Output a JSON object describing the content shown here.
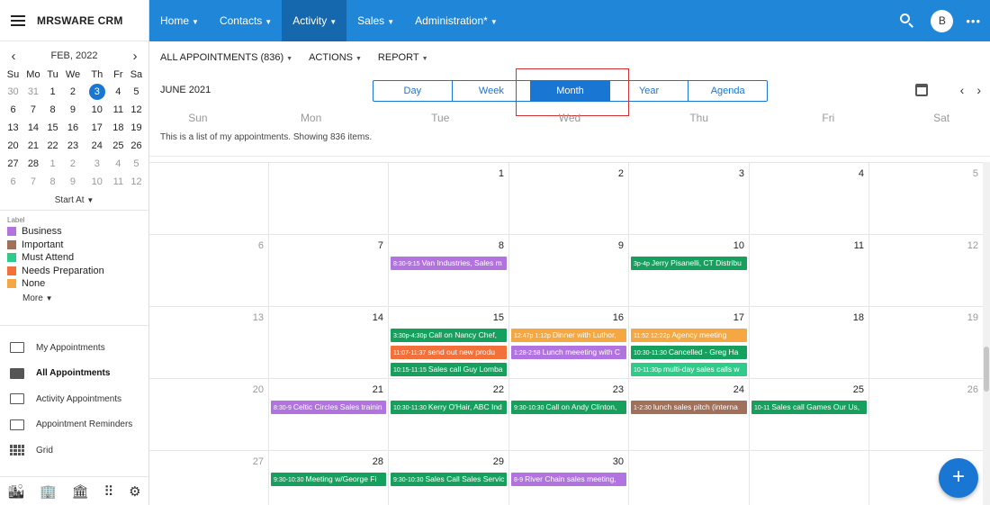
{
  "app": {
    "title": "MRSWARE CRM"
  },
  "colors": {
    "topbar": "#1f86d8",
    "accent": "#1976d2",
    "business": "#b173e0",
    "important": "#a0705a",
    "must_attend": "#2ecc8a",
    "needs_preparation": "#f2703a",
    "none": "#f5a742",
    "event_green": "#16a05e"
  },
  "nav": {
    "items": [
      {
        "label": "Home"
      },
      {
        "label": "Contacts"
      },
      {
        "label": "Activity"
      },
      {
        "label": "Sales"
      },
      {
        "label": "Administration*"
      }
    ],
    "avatar_letter": "B",
    "more_icon": "•••"
  },
  "mini_calendar": {
    "title": "FEB, 2022",
    "prev": "‹",
    "next": "›",
    "weekdays": [
      "Su",
      "Mo",
      "Tu",
      "We",
      "Th",
      "Fr",
      "Sa"
    ],
    "weeks": [
      [
        "30",
        "31",
        "1",
        "2",
        "3",
        "4",
        "5"
      ],
      [
        "6",
        "7",
        "8",
        "9",
        "10",
        "11",
        "12"
      ],
      [
        "13",
        "14",
        "15",
        "16",
        "17",
        "18",
        "19"
      ],
      [
        "20",
        "21",
        "22",
        "23",
        "24",
        "25",
        "26"
      ],
      [
        "27",
        "28",
        "1",
        "2",
        "3",
        "4",
        "5"
      ],
      [
        "6",
        "7",
        "8",
        "9",
        "10",
        "11",
        "12"
      ]
    ],
    "start_at_label": "Start At"
  },
  "labels": {
    "caption": "Label",
    "items": [
      {
        "name": "Business",
        "color": "#b173e0"
      },
      {
        "name": "Important",
        "color": "#a0705a"
      },
      {
        "name": "Must Attend",
        "color": "#2ecc8a"
      },
      {
        "name": "Needs Preparation",
        "color": "#f2703a"
      },
      {
        "name": "None",
        "color": "#f5a742"
      }
    ],
    "more_label": "More"
  },
  "views": [
    {
      "label": "My Appointments"
    },
    {
      "label": "All Appointments"
    },
    {
      "label": "Activity Appointments"
    },
    {
      "label": "Appointment Reminders"
    },
    {
      "label": "Grid"
    }
  ],
  "toolbar": {
    "all_appointments": "ALL APPOINTMENTS (836)",
    "actions": "ACTIONS",
    "report": "REPORT"
  },
  "calendar": {
    "month_label": "JUNE 2021",
    "view_tabs": [
      "Day",
      "Week",
      "Month",
      "Year",
      "Agenda"
    ],
    "active_view": "Month",
    "day_names": [
      "Sun",
      "Mon",
      "Tue",
      "Wed",
      "Thu",
      "Fri",
      "Sat"
    ],
    "info": "This is a list of my appointments. Showing 836 items.",
    "weeks": [
      [
        "",
        "",
        "1",
        "2",
        "3",
        "4",
        "5"
      ],
      [
        "6",
        "7",
        "8",
        "9",
        "10",
        "11",
        "12"
      ],
      [
        "13",
        "14",
        "15",
        "16",
        "17",
        "18",
        "19"
      ],
      [
        "20",
        "21",
        "22",
        "23",
        "24",
        "25",
        "26"
      ],
      [
        "27",
        "28",
        "29",
        "30",
        "",
        "",
        ""
      ]
    ],
    "events": [
      {
        "week": 1,
        "day": 2,
        "slot": 0,
        "time": "8:30-9:15",
        "text": "Van Industries, Sales m",
        "color": "#b173e0"
      },
      {
        "week": 1,
        "day": 4,
        "slot": 0,
        "time": "3p-4p",
        "text": "Jerry Pisanelli, CT Distribu",
        "color": "#16a05e"
      },
      {
        "week": 2,
        "day": 2,
        "slot": 0,
        "time": "3:30p-4:30p",
        "text": "Call on Nancy Chef,",
        "color": "#16a05e"
      },
      {
        "week": 2,
        "day": 2,
        "slot": 1,
        "time": "11:07-11:37",
        "text": "send out new produ",
        "color": "#f2703a"
      },
      {
        "week": 2,
        "day": 2,
        "slot": 2,
        "time": "10:15-11:15",
        "text": "Sales call Guy Lomba",
        "color": "#16a05e"
      },
      {
        "week": 2,
        "day": 3,
        "slot": 0,
        "time": "12:47p 1:12p",
        "text": "Dinner with Luthor,",
        "color": "#f5a742"
      },
      {
        "week": 2,
        "day": 3,
        "slot": 1,
        "time": "1:28-2:58",
        "text": "Lunch meeeting with C",
        "color": "#b173e0"
      },
      {
        "week": 2,
        "day": 4,
        "slot": 0,
        "time": "11:52 12:22p",
        "text": "Agency meeting",
        "color": "#f5a742"
      },
      {
        "week": 2,
        "day": 4,
        "slot": 1,
        "time": "10:30-11:30",
        "text": "Cancelled - Greg Ha",
        "color": "#16a05e"
      },
      {
        "week": 2,
        "day": 4,
        "slot": 2,
        "time": "10-11:30p",
        "text": "multi-day sales calls w",
        "color": "#2ecc8a"
      },
      {
        "week": 3,
        "day": 1,
        "slot": 0,
        "time": "8:30-9",
        "text": "Celtic Circles Sales trainin",
        "color": "#b173e0"
      },
      {
        "week": 3,
        "day": 2,
        "slot": 0,
        "time": "10:30-11:30",
        "text": "Kerry O'Hair, ABC Ind",
        "color": "#16a05e"
      },
      {
        "week": 3,
        "day": 3,
        "slot": 0,
        "time": "9:30-10:30",
        "text": "Call on Andy Clinton,",
        "color": "#16a05e"
      },
      {
        "week": 3,
        "day": 4,
        "slot": 0,
        "time": "1-2:30",
        "text": "lunch sales pitch (interna",
        "color": "#a0705a"
      },
      {
        "week": 3,
        "day": 5,
        "slot": 0,
        "time": "10-11",
        "text": "Sales call Games Our Us,",
        "color": "#16a05e"
      },
      {
        "week": 4,
        "day": 1,
        "slot": 0,
        "time": "9:30-10:30",
        "text": "Meeting w/George Fi",
        "color": "#16a05e"
      },
      {
        "week": 4,
        "day": 2,
        "slot": 0,
        "time": "9:30-10:30",
        "text": "Sales Call Sales Servic",
        "color": "#16a05e"
      },
      {
        "week": 4,
        "day": 3,
        "slot": 0,
        "time": "8-9",
        "text": "River Chain sales meeting,",
        "color": "#b173e0"
      }
    ]
  },
  "fab_label": "+"
}
